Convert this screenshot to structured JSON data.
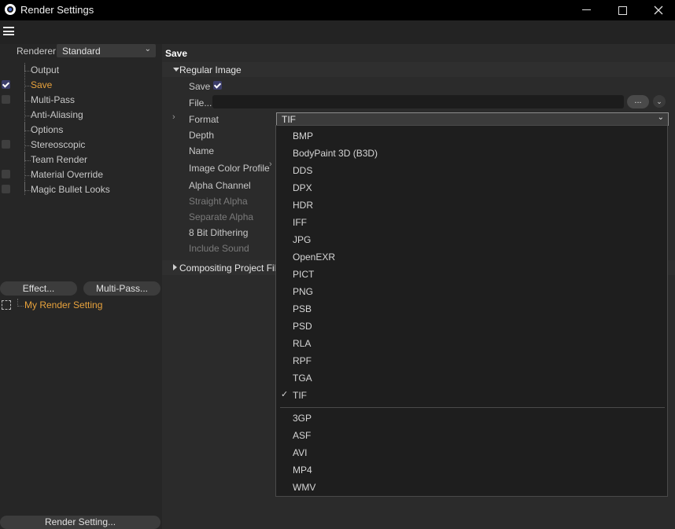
{
  "window": {
    "title": "Render Settings",
    "controls": {
      "minimize": "—",
      "maximize": "☐",
      "close": "✕"
    }
  },
  "left": {
    "renderer_label": "Renderer",
    "renderer_value": "Standard",
    "items": [
      {
        "label": "Output",
        "checkbox": false,
        "checked": false,
        "active": false
      },
      {
        "label": "Save",
        "checkbox": true,
        "checked": true,
        "active": true
      },
      {
        "label": "Multi-Pass",
        "checkbox": true,
        "checked": false,
        "active": false
      },
      {
        "label": "Anti-Aliasing",
        "checkbox": false,
        "checked": false,
        "active": false
      },
      {
        "label": "Options",
        "checkbox": false,
        "checked": false,
        "active": false
      },
      {
        "label": "Stereoscopic",
        "checkbox": true,
        "checked": false,
        "active": false
      },
      {
        "label": "Team Render",
        "checkbox": false,
        "checked": false,
        "active": false
      },
      {
        "label": "Material Override",
        "checkbox": true,
        "checked": false,
        "active": false
      },
      {
        "label": "Magic Bullet Looks",
        "checkbox": true,
        "checked": false,
        "active": false
      }
    ],
    "effect_button": "Effect...",
    "multipass_button": "Multi-Pass...",
    "render_setting_name": "My Render Setting",
    "render_setting_button": "Render Setting..."
  },
  "right": {
    "header": "Save",
    "group_title": "Regular Image",
    "params": {
      "save": "Save",
      "file": "File...",
      "format": "Format",
      "depth": "Depth",
      "name": "Name",
      "image_color_profile": "Image Color Profile",
      "alpha_channel": "Alpha Channel",
      "straight_alpha": "Straight Alpha",
      "separate_alpha": "Separate Alpha",
      "dithering": "8 Bit Dithering",
      "include_sound": "Include Sound"
    },
    "file_browse": "...",
    "format_value": "TIF",
    "compositing_title": "Compositing Project File"
  },
  "dropdown": {
    "group1": [
      "BMP",
      "BodyPaint 3D (B3D)",
      "DDS",
      "DPX",
      "HDR",
      "IFF",
      "JPG",
      "OpenEXR",
      "PICT",
      "PNG",
      "PSB",
      "PSD",
      "RLA",
      "RPF",
      "TGA",
      "TIF"
    ],
    "group2": [
      "3GP",
      "ASF",
      "AVI",
      "MP4",
      "WMV"
    ],
    "selected": "TIF"
  },
  "colors": {
    "accent": "#e8a23c",
    "check": "#3b3d6a"
  }
}
